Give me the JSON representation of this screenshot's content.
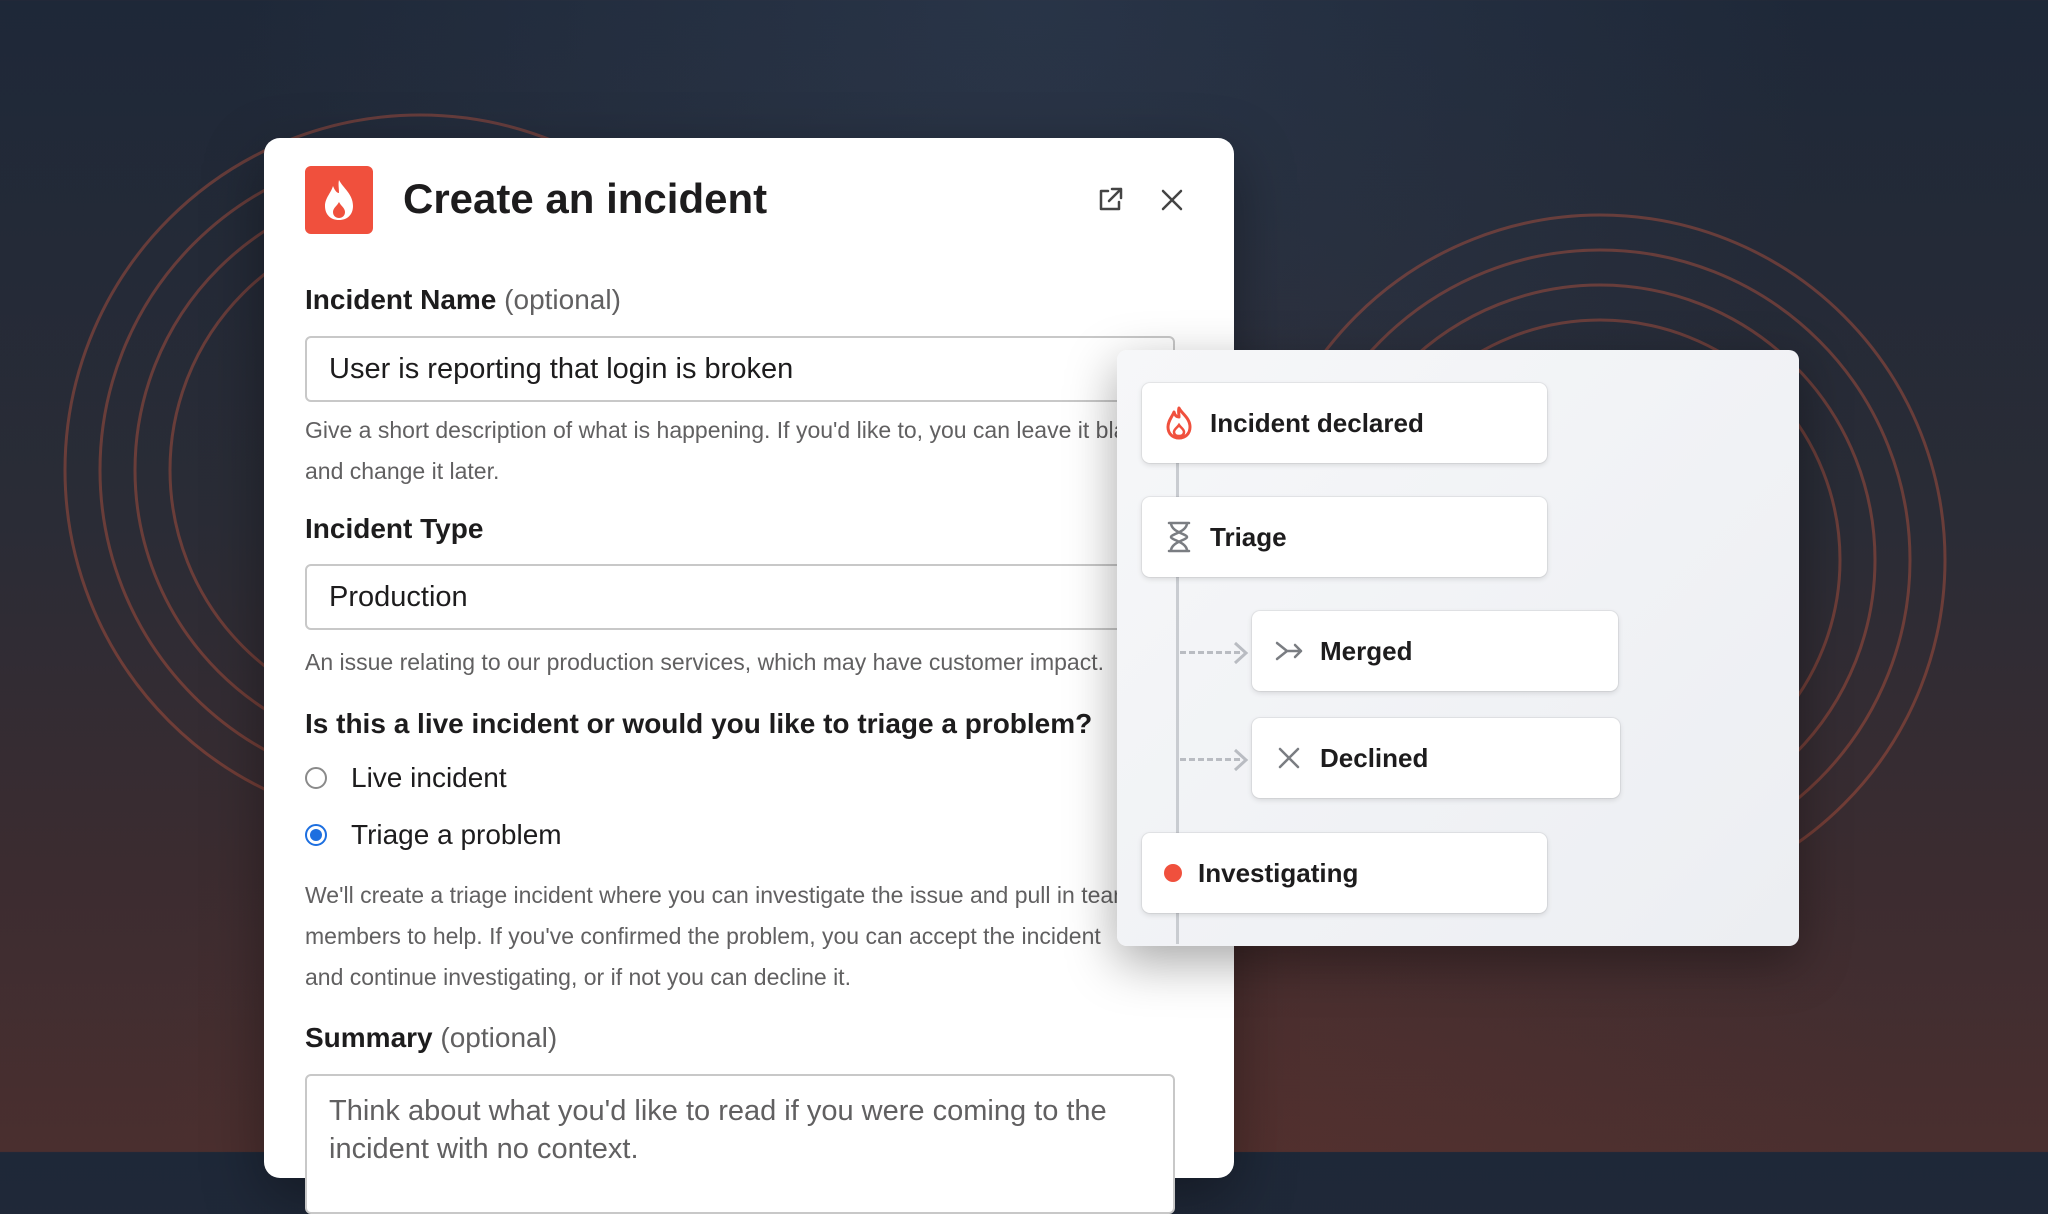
{
  "modal": {
    "title": "Create an incident",
    "name_field": {
      "label": "Incident Name",
      "optional": "(optional)",
      "value": "User is reporting that login is broken",
      "help": "Give a short description of what is happening. If you'd like to, you can leave it blank and change it later."
    },
    "type_field": {
      "label": "Incident Type",
      "value": "Production",
      "help": "An issue relating to our production services, which may have customer impact."
    },
    "mode_question": {
      "label": "Is this a live incident or would you like to triage a problem?",
      "options": [
        {
          "label": "Live incident",
          "checked": false
        },
        {
          "label": "Triage a problem",
          "checked": true
        }
      ],
      "help": "We'll create a triage incident where you can investigate the issue and pull in team members to help. If you've confirmed the problem, you can accept the incident and continue investigating, or if not you can decline it."
    },
    "summary_field": {
      "label": "Summary",
      "optional": "(optional)",
      "placeholder": "Think about what you'd like to read if you were coming to the incident with no context."
    }
  },
  "timeline": {
    "steps": [
      {
        "label": "Incident declared",
        "icon": "flame-icon"
      },
      {
        "label": "Triage",
        "icon": "hourglass-icon"
      },
      {
        "label": "Merged",
        "icon": "merge-arrow-icon"
      },
      {
        "label": "Declined",
        "icon": "x-icon"
      },
      {
        "label": "Investigating",
        "icon": "status-dot"
      }
    ]
  },
  "colors": {
    "brand": "#f0503d",
    "radio_selected": "#1d6fe0",
    "text": "#1d1c1d",
    "muted": "#616061"
  }
}
